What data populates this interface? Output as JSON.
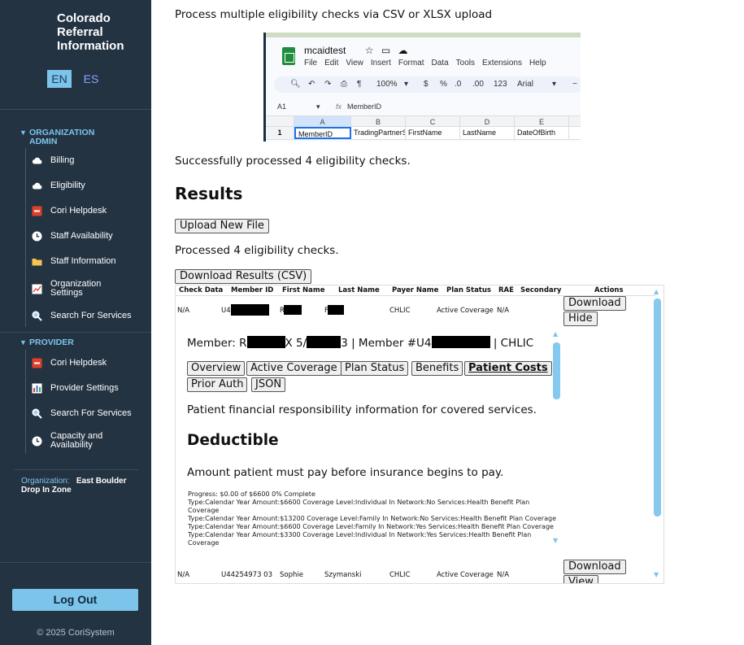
{
  "sidebar": {
    "brand": [
      "Colorado",
      "Referral",
      "Information"
    ],
    "lang_en": "EN",
    "lang_es": "ES",
    "sections": {
      "org_admin": {
        "title_1": "ORGANIZATION",
        "title_2": "ADMIN",
        "items": [
          {
            "label": "Billing",
            "icon": "cloud-icon"
          },
          {
            "label": "Eligibility",
            "icon": "cloud-icon"
          },
          {
            "label": "Cori Helpdesk",
            "icon": "helpdesk-icon"
          },
          {
            "label": "Staff Availability",
            "icon": "clock-icon"
          },
          {
            "label": "Staff Information",
            "icon": "folder-icon"
          },
          {
            "label_1": "Organization",
            "label_2": "Settings",
            "icon": "chart-icon"
          },
          {
            "label": "Search For Services",
            "icon": "search-icon"
          }
        ]
      },
      "provider": {
        "title": "PROVIDER",
        "items": [
          {
            "label": "Cori Helpdesk",
            "icon": "helpdesk-icon"
          },
          {
            "label": "Provider Settings",
            "icon": "bar-chart-icon"
          },
          {
            "label": "Search For Services",
            "icon": "search-icon"
          },
          {
            "label_1": "Capacity and",
            "label_2": "Availability",
            "icon": "clock-icon"
          }
        ]
      }
    },
    "organization_label": "Organization:",
    "organization_value_1": "East Boulder",
    "organization_value_2": "Drop In Zone",
    "logout": "Log Out",
    "copyright": "© 2025 CoriSystem"
  },
  "main": {
    "intro": "Process multiple eligibility checks via CSV or XLSX upload",
    "sheet": {
      "filename": "mcaidtest",
      "menus": [
        "File",
        "Edit",
        "View",
        "Insert",
        "Format",
        "Data",
        "Tools",
        "Extensions",
        "Help"
      ],
      "zoom": "100%",
      "currency": "$",
      "percent": "%",
      "dec_minus": ".0",
      "dec_plus": ".00",
      "number_format": "123",
      "font": "Arial",
      "cell_ref": "A1",
      "fx": "fx",
      "formula_value": "MemberID",
      "col_headers": [
        "A",
        "B",
        "C",
        "D",
        "E"
      ],
      "row_number": "1",
      "row_values": [
        "MemberID",
        "TradingPartnerS",
        "FirstName",
        "LastName",
        "DateOfBirth"
      ]
    },
    "success_message": "Successfully processed 4 eligibility checks.",
    "results_heading": "Results",
    "upload_new_file": "Upload New File",
    "processed_message": "Processed 4 eligibility checks.",
    "download_results": "Download Results (CSV)",
    "table": {
      "headers": [
        "Check Data",
        "Member ID",
        "First Name",
        "Last Name",
        "Payer Name",
        "Plan Status",
        "RAE",
        "Secondary",
        "Actions"
      ],
      "row1": {
        "check": "N/A",
        "member_id": "U4",
        "first": "R",
        "last": "F",
        "payer": "CHLIC",
        "status": "Active Coverage",
        "rae": "N/A",
        "download": "Download",
        "hide": "Hide"
      },
      "row2": {
        "check": "N/A",
        "member_id": "U44254973 03",
        "first": "Sophie",
        "last": "Szymanski",
        "payer": "CHLIC",
        "status": "Active Coverage",
        "rae": "N/A",
        "download": "Download",
        "view": "View"
      }
    },
    "detail": {
      "member_line_a": "Member: R",
      "member_line_b": "X 5/",
      "member_line_c": "3 | Member #U4",
      "member_line_d": "| CHLIC",
      "tabs": [
        "Overview",
        "Active Coverage",
        "Plan Status",
        "Benefits",
        "Patient Costs",
        "Prior Auth",
        "JSON"
      ],
      "description": "Patient financial responsibility information for covered services.",
      "deductible_heading": "Deductible",
      "deductible_text": "Amount patient must pay before insurance begins to pay.",
      "lines": [
        "Progress: $0.00 of $6600 0% Complete",
        "Type:Calendar Year Amount:$6600 Coverage Level:Individual In Network:No Services:Health Benefit Plan",
        "Coverage",
        "Type:Calendar Year Amount:$13200 Coverage Level:Family In Network:No Services:Health Benefit Plan Coverage",
        "Type:Calendar Year Amount:$6600 Coverage Level:Family In Network:Yes Services:Health Benefit Plan Coverage",
        "Type:Calendar Year Amount:$3300 Coverage Level:Individual In Network:Yes Services:Health Benefit Plan",
        "Coverage"
      ]
    }
  },
  "colors": {
    "sidebar_bg": "#243342",
    "accent": "#7cc4ea",
    "scroll_thumb": "#86c9ee"
  }
}
